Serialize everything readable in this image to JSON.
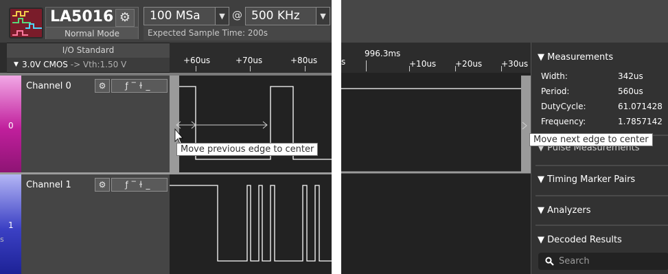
{
  "device": {
    "name": "LA5016",
    "mode": "Normal Mode",
    "sample_rate": "100 MSa",
    "at": "@",
    "frequency": "500 KHz",
    "expected_time": "Expected Sample Time: 200s"
  },
  "io": {
    "header": "I/O Standard",
    "standard": "3.0V CMOS",
    "vth": "-> Vth:1.50 V"
  },
  "ruler_left": {
    "ticks": [
      "+60us",
      "+70us",
      "+80us"
    ]
  },
  "ruler_right": {
    "partial": "s",
    "center": "996.3ms",
    "ticks": [
      "+10us",
      "+20us",
      "+30us"
    ]
  },
  "channels": [
    {
      "label": "Channel 0",
      "index": "0",
      "buttons": [
        "⚙",
        "ꜰ",
        "‾",
        "ᶚ",
        "_"
      ]
    },
    {
      "label": "Channel 1",
      "index": "1",
      "buttons": [
        "⚙",
        "ꜰ",
        "‾",
        "ᶚ",
        "_"
      ]
    }
  ],
  "edge_glyphs": [
    "Ⴔ",
    "‾",
    "Ⴕ",
    "_"
  ],
  "left_cut_letter": "s",
  "tooltips": {
    "prev": "Move previous edge to center",
    "next": "Move next edge to center"
  },
  "measurements": {
    "title": "▼ Measurements",
    "rows": [
      {
        "key": "Width:",
        "value": "342us"
      },
      {
        "key": "Period:",
        "value": "560us"
      },
      {
        "key": "DutyCycle:",
        "value": "61.071428"
      },
      {
        "key": "Frequency:",
        "value": "1.7857142"
      }
    ]
  },
  "sections": {
    "pulse": "▼ Pulse Measurements",
    "timing": "▼ Timing Marker Pairs",
    "analyzers": "▼ Analyzers",
    "decoded": "▼ Decoded Results"
  },
  "search": {
    "placeholder": "Search"
  },
  "colors": {
    "channel0": "#c01f9c",
    "channel1": "#3b40c4",
    "trace": "#ffffff"
  }
}
